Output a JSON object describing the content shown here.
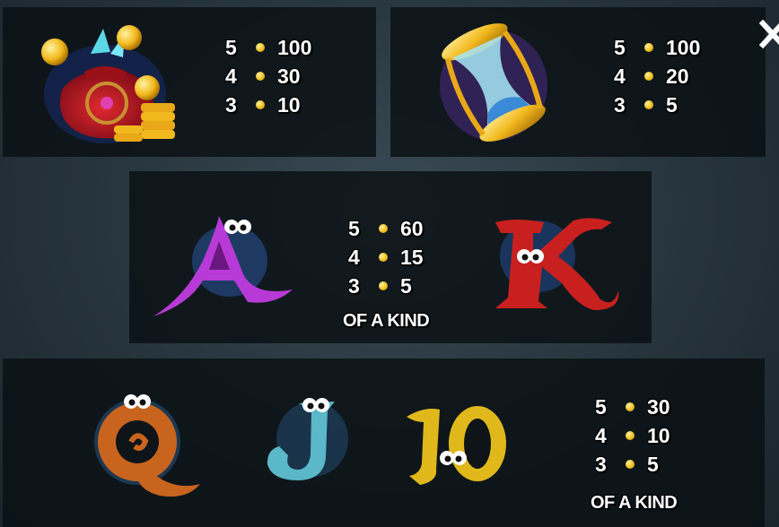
{
  "close_icon": "close-icon",
  "panels": [
    {
      "symbol": "treasure-bag-icon",
      "rows": [
        {
          "count": "5",
          "value": "100"
        },
        {
          "count": "4",
          "value": "30"
        },
        {
          "count": "3",
          "value": "10"
        }
      ]
    },
    {
      "symbol": "hourglass-icon",
      "rows": [
        {
          "count": "5",
          "value": "100"
        },
        {
          "count": "4",
          "value": "20"
        },
        {
          "count": "3",
          "value": "5"
        }
      ]
    },
    {
      "symbols": [
        "letter-a-icon",
        "letter-k-icon"
      ],
      "rows": [
        {
          "count": "5",
          "value": "60"
        },
        {
          "count": "4",
          "value": "15"
        },
        {
          "count": "3",
          "value": "5"
        }
      ],
      "caption": "OF A KIND"
    },
    {
      "symbols": [
        "letter-q-icon",
        "letter-j-icon",
        "number-10-icon"
      ],
      "rows": [
        {
          "count": "5",
          "value": "30"
        },
        {
          "count": "4",
          "value": "10"
        },
        {
          "count": "3",
          "value": "5"
        }
      ],
      "caption": "OF A KIND"
    }
  ],
  "colors": {
    "panel_bg": "#0a1014",
    "coin": "#f0c020",
    "letter_a": "#b83ad6",
    "letter_k": "#c8201e",
    "letter_q": "#c8641e",
    "letter_j": "#5ab8c8",
    "number_10": "#e0b81c"
  }
}
